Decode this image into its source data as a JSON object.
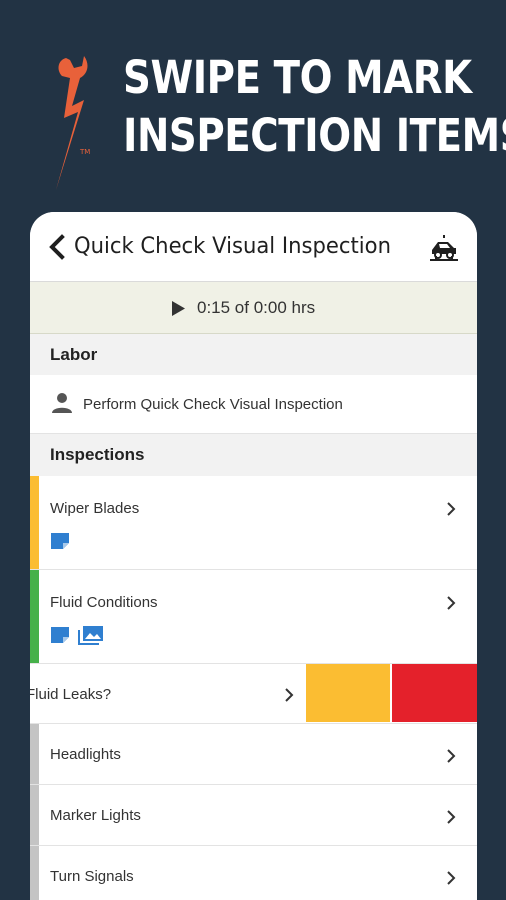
{
  "promo": {
    "headline_line1": "SWIPE TO MARK",
    "headline_line2": "INSPECTION ITEMS",
    "trademark": "TM",
    "logo_icon": "wrench-lightning-icon",
    "accent_color": "#e8613a"
  },
  "app": {
    "title": "Quick Check Visual Inspection",
    "back_icon": "chevron-left-icon",
    "action_icon": "vehicle-lift-icon"
  },
  "timer": {
    "text": "0:15 of 0:00 hrs",
    "icon": "play-icon"
  },
  "labor": {
    "header": "Labor",
    "item": "Perform Quick Check Visual Inspection",
    "icon": "person-icon"
  },
  "inspections": {
    "header": "Inspections",
    "items": [
      {
        "label": "Wiper Blades",
        "status_color": "#fbbd32",
        "badges": [
          "note-icon"
        ]
      },
      {
        "label": "Fluid Conditions",
        "status_color": "#46b14a",
        "badges": [
          "note-icon",
          "photo-icon"
        ]
      },
      {
        "label": "Fluid Leaks?",
        "status_color": "#ffffff",
        "swipe_actions": [
          "#fbbd32",
          "#e4212b"
        ]
      },
      {
        "label": "Headlights",
        "status_color": "#c4c4c4"
      },
      {
        "label": "Marker Lights",
        "status_color": "#c4c4c4"
      },
      {
        "label": "Turn Signals",
        "status_color": "#c4c4c4"
      }
    ]
  },
  "colors": {
    "background": "#223344",
    "timer_bar": "#f0f1e6",
    "yellow": "#fbbd32",
    "green": "#46b14a",
    "red": "#e4212b",
    "gray": "#c4c4c4",
    "badge_blue": "#2f7fd0"
  }
}
